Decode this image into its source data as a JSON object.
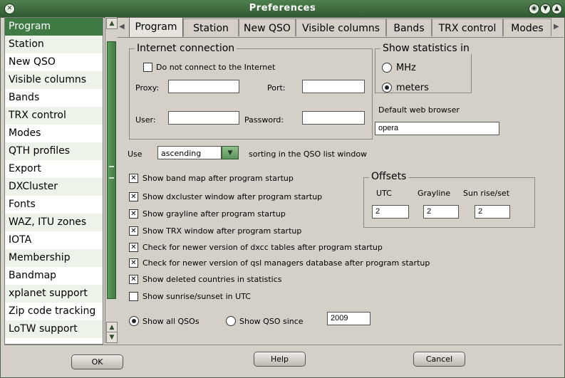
{
  "window": {
    "title": "Preferences",
    "close_glyph": "✕",
    "ctrl_glyphs": [
      "◉",
      "▼",
      "▲"
    ]
  },
  "sidebar": {
    "items": [
      {
        "label": "Program"
      },
      {
        "label": "Station"
      },
      {
        "label": "New QSO"
      },
      {
        "label": "Visible columns"
      },
      {
        "label": "Bands"
      },
      {
        "label": "TRX control"
      },
      {
        "label": "Modes"
      },
      {
        "label": "QTH profiles"
      },
      {
        "label": "Export"
      },
      {
        "label": "DXCluster"
      },
      {
        "label": "Fonts"
      },
      {
        "label": "WAZ, ITU zones"
      },
      {
        "label": "IOTA"
      },
      {
        "label": "Membership"
      },
      {
        "label": "Bandmap"
      },
      {
        "label": "xplanet support"
      },
      {
        "label": "Zip code tracking"
      },
      {
        "label": "LoTW support"
      }
    ],
    "selected_index": 0
  },
  "tabs": {
    "items": [
      {
        "label": "Program"
      },
      {
        "label": "Station"
      },
      {
        "label": "New QSO"
      },
      {
        "label": "Visible columns"
      },
      {
        "label": "Bands"
      },
      {
        "label": "TRX control"
      },
      {
        "label": "Modes"
      }
    ],
    "active": "Program"
  },
  "internet": {
    "title": "Internet connection",
    "no_connect_label": "Do not connect to the Internet",
    "no_connect_checked": false,
    "proxy_label": "Proxy:",
    "proxy_value": "",
    "port_label": "Port:",
    "port_value": "",
    "user_label": "User:",
    "user_value": "",
    "password_label": "Password:",
    "password_value": ""
  },
  "stats": {
    "title": "Show statistics in",
    "mhz_label": "MHz",
    "meters_label": "meters",
    "selected": "meters"
  },
  "browser": {
    "label": "Default web browser",
    "value": "opera"
  },
  "sorting": {
    "use_label": "Use",
    "value": "ascending",
    "suffix": "sorting in the QSO list  window",
    "arrow_glyph": "▼"
  },
  "options": [
    {
      "label": "Show band map after program startup",
      "checked": true
    },
    {
      "label": "Show dxcluster window after program startup",
      "checked": true
    },
    {
      "label": "Show grayline after program startup",
      "checked": true
    },
    {
      "label": "Show TRX window after program startup",
      "checked": true
    },
    {
      "label": "Check for newer version of dxcc tables after program startup",
      "checked": true
    },
    {
      "label": "Check for newer version of qsl managers database  after program startup",
      "checked": true
    },
    {
      "label": "Show deleted countries in statistics",
      "checked": true
    },
    {
      "label": "Show sunrise/sunset in UTC",
      "checked": false
    }
  ],
  "check_glyph": "✕",
  "offsets": {
    "title": "Offsets",
    "utc_label": "UTC",
    "utc_value": "2",
    "grayline_label": "Grayline",
    "grayline_value": "2",
    "sun_label": "Sun rise/set",
    "sun_value": "2"
  },
  "qso_show": {
    "all_label": "Show all QSOs",
    "since_label": "Show QSO since",
    "since_value": "2009",
    "selected": "all"
  },
  "buttons": {
    "ok": "OK",
    "help": "Help",
    "cancel": "Cancel"
  },
  "colors": {
    "accent": "#3f7a45",
    "titlebar": "#2f5a31"
  }
}
